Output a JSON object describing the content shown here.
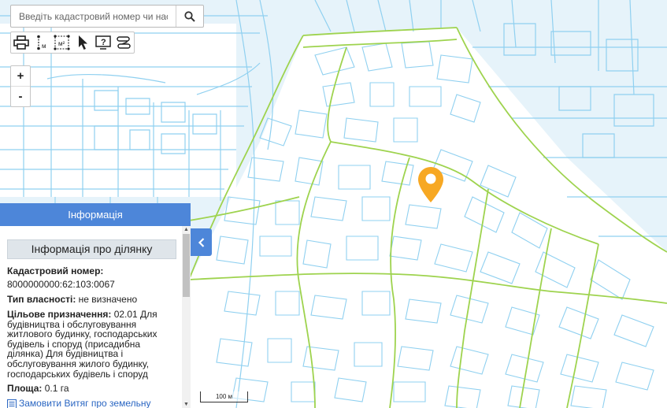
{
  "search": {
    "placeholder": "Введіть кадастровий номер чи насе"
  },
  "toolbar": {
    "items": [
      "print-icon",
      "measure-length-icon",
      "measure-area-icon",
      "pointer-icon",
      "help-icon",
      "layers-switch-icon"
    ]
  },
  "zoom": {
    "in_label": "+",
    "out_label": "-"
  },
  "panel": {
    "header": "Інформація",
    "section_title": "Інформація про ділянку",
    "cadastral_label": "Кадастровий номер:",
    "cadastral_value": "8000000000:62:103:0067",
    "ownership_label": "Тип власності:",
    "ownership_value": "не визначено",
    "purpose_label": "Цільове призначення:",
    "purpose_value": "02.01 Для будівництва і обслуговування житлового будинку, господарських будівель і споруд (присадибна ділянка) Для будівництва і обслуговування жилого будинку, господарських будівель і споруд",
    "area_label": "Площа:",
    "area_value": "0.1 га",
    "order_link": "Замовити Витяг про земельну ділянку"
  },
  "scale": {
    "label": "100 м"
  },
  "colors": {
    "panel_blue": "#4d86d9",
    "parcel_line": "#8fd0f0",
    "boundary_green": "#9ed34e",
    "marker": "#f7a823",
    "map_bg": "#e6f3fa"
  }
}
